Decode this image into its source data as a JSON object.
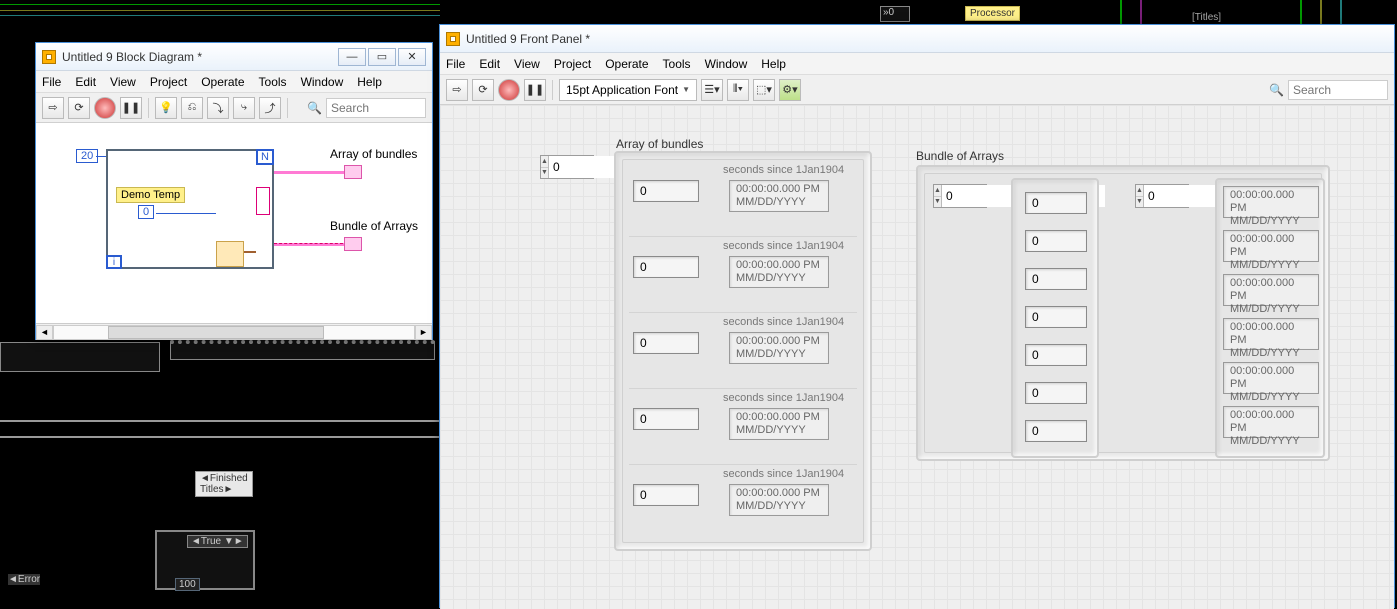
{
  "bg": {
    "processor_label": "Processor",
    "finished_titles": "◄Finished Titles►",
    "true_label": "◄True ▼►",
    "error_label": "◄Error",
    "nzero": "»0",
    "hundred": "100",
    "titles": "[Titles]"
  },
  "block_diagram_window": {
    "title": "Untitled 9 Block Diagram *",
    "menu": [
      "File",
      "Edit",
      "View",
      "Project",
      "Operate",
      "Tools",
      "Window",
      "Help"
    ],
    "search_placeholder": "Search",
    "loop_count": "20",
    "loop_N": "N",
    "loop_i": "i",
    "demo_temp_label": "Demo Temp",
    "demo_temp_value": "0",
    "out1_label": "Array of bundles",
    "out2_label": "Bundle of Arrays"
  },
  "front_panel_window": {
    "title": "Untitled 9 Front Panel *",
    "menu": [
      "File",
      "Edit",
      "View",
      "Project",
      "Operate",
      "Tools",
      "Window",
      "Help"
    ],
    "font": "15pt Application Font",
    "search_placeholder": "Search",
    "array_of_bundles": {
      "label": "Array of bundles",
      "index": "0",
      "rows": [
        {
          "num": "0",
          "ts_label": "seconds since 1Jan1904",
          "ts1": "00:00:00.000 PM",
          "ts2": "MM/DD/YYYY"
        },
        {
          "num": "0",
          "ts_label": "seconds since 1Jan1904",
          "ts1": "00:00:00.000 PM",
          "ts2": "MM/DD/YYYY"
        },
        {
          "num": "0",
          "ts_label": "seconds since 1Jan1904",
          "ts1": "00:00:00.000 PM",
          "ts2": "MM/DD/YYYY"
        },
        {
          "num": "0",
          "ts_label": "seconds since 1Jan1904",
          "ts1": "00:00:00.000 PM",
          "ts2": "MM/DD/YYYY"
        },
        {
          "num": "0",
          "ts_label": "seconds since 1Jan1904",
          "ts1": "00:00:00.000 PM",
          "ts2": "MM/DD/YYYY"
        }
      ]
    },
    "bundle_of_arrays": {
      "label": "Bundle of Arrays",
      "col1_index": "0",
      "col2_index": "0",
      "col1_values": [
        "0",
        "0",
        "0",
        "0",
        "0",
        "0",
        "0"
      ],
      "col2_values": [
        {
          "t1": "00:00:00.000 PM",
          "t2": "MM/DD/YYYY"
        },
        {
          "t1": "00:00:00.000 PM",
          "t2": "MM/DD/YYYY"
        },
        {
          "t1": "00:00:00.000 PM",
          "t2": "MM/DD/YYYY"
        },
        {
          "t1": "00:00:00.000 PM",
          "t2": "MM/DD/YYYY"
        },
        {
          "t1": "00:00:00.000 PM",
          "t2": "MM/DD/YYYY"
        },
        {
          "t1": "00:00:00.000 PM",
          "t2": "MM/DD/YYYY"
        }
      ]
    }
  }
}
